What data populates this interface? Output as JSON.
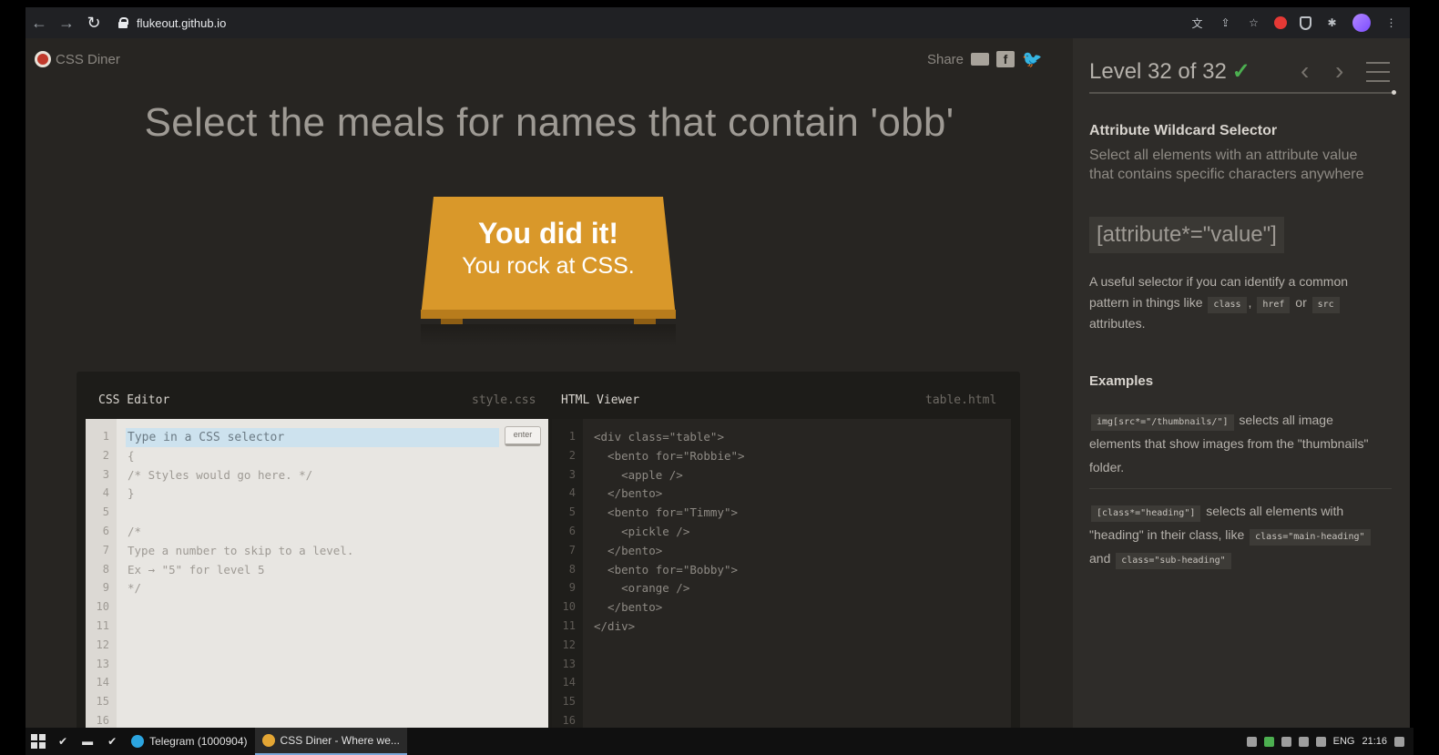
{
  "browser": {
    "url": "flukeout.github.io",
    "back_icon": "←",
    "forward_icon": "→",
    "reload_icon": "↻",
    "star_icon": "☆",
    "puzzle_icon": "✱",
    "more_icon": "⋮"
  },
  "game": {
    "logo_text": "CSS Diner",
    "share_label": "Share",
    "order": "Select the meals for names that contain 'obb'",
    "win_line1": "You did it!",
    "win_line2": "You rock at CSS."
  },
  "css_editor": {
    "title": "CSS Editor",
    "filename": "style.css",
    "input_placeholder": "Type in a CSS selector",
    "enter_label": "enter",
    "line_numbers": [
      "1",
      "2",
      "3",
      "4",
      "5",
      "6",
      "7",
      "8",
      "9",
      "10",
      "11",
      "12",
      "13",
      "14",
      "15",
      "16"
    ],
    "lines": [
      "{",
      "/* Styles would go here. */",
      "}",
      "",
      "/*",
      "Type a number to skip to a level.",
      "Ex → \"5\" for level 5",
      "*/"
    ]
  },
  "html_viewer": {
    "title": "HTML Viewer",
    "filename": "table.html",
    "line_numbers": [
      "1",
      "2",
      "3",
      "4",
      "5",
      "6",
      "7",
      "8",
      "9",
      "10",
      "11",
      "12",
      "13",
      "14",
      "15",
      "16"
    ],
    "lines": [
      "<div class=\"table\">",
      "  <bento for=\"Robbie\">",
      "    <apple />",
      "  </bento>",
      "  <bento for=\"Timmy\">",
      "    <pickle />",
      "  </bento>",
      "  <bento for=\"Bobby\">",
      "    <orange />",
      "  </bento>",
      "</div>"
    ]
  },
  "sidebar": {
    "level_title": "Level 32 of 32",
    "check": "✓",
    "prev_icon": "‹",
    "next_icon": "›",
    "selector_name": "Attribute Wildcard Selector",
    "selector_title": "Select all elements with an attribute value that contains specific characters anywhere",
    "syntax": "[attribute*=\"value\"]",
    "hint_before": "A useful selector if you can identify a common pattern in things like",
    "hint_tag1": "class",
    "hint_comma": ",",
    "hint_tag2": "href",
    "hint_or": "or",
    "hint_tag3": "src",
    "hint_after": "attributes.",
    "examples_heading": "Examples",
    "ex1_code": "img[src*=\"/thumbnails/\"]",
    "ex1_text": "selects all image elements that show images from the \"thumbnails\" folder.",
    "ex2_code": "[class*=\"heading\"]",
    "ex2_text": "selects all elements with \"heading\" in their class, like",
    "ex2_code2": "class=\"main-heading\"",
    "ex2_and": "and",
    "ex2_code3": "class=\"sub-heading\""
  },
  "taskbar": {
    "telegram_label": "Telegram (1000904)",
    "chrome_label": "CSS Diner - Where we...",
    "lang": "ENG",
    "time": "21:16"
  },
  "colors": {
    "table": "#d9982a",
    "check": "#4caf50",
    "logo": "#c0392b"
  }
}
